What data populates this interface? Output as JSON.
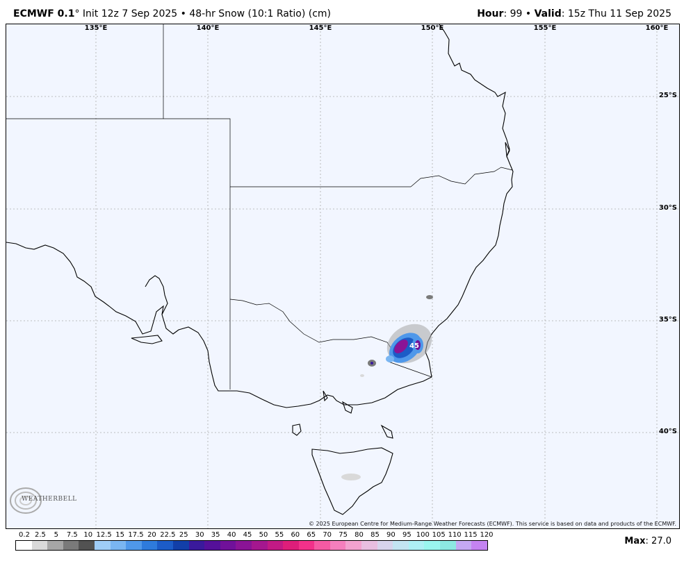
{
  "header": {
    "model": "ECMWF 0.1",
    "degree_mark": "°",
    "init": "Init 12z 7 Sep 2025",
    "bullet": "•",
    "product": "48-hr Snow (10:1 Ratio) (cm)",
    "hour_label": "Hour",
    "hour_value": ": 99",
    "valid_label": "Valid",
    "valid_value": ": 15z Thu 11 Sep 2025"
  },
  "map": {
    "longitude_labels": [
      "135°E",
      "140°E",
      "145°E",
      "150°E",
      "155°E",
      "160°E"
    ],
    "latitude_labels": [
      "25°S",
      "30°S",
      "35°S",
      "40°S"
    ],
    "contour_label": "45",
    "logo_text": "WEATHERBELL",
    "credit": "© 2025 European Centre for Medium-Range Weather Forecasts (ECMWF). This service is based on data and products of the ECMWF."
  },
  "legend": {
    "labels": [
      "0.2",
      "2.5",
      "5",
      "7.5",
      "10",
      "12.5",
      "15",
      "17.5",
      "20",
      "22.5",
      "25",
      "30",
      "35",
      "40",
      "45",
      "50",
      "55",
      "60",
      "65",
      "70",
      "75",
      "80",
      "85",
      "90",
      "95",
      "100",
      "105",
      "110",
      "115",
      "120"
    ],
    "colors": [
      "#ffffff",
      "#d9d9d9",
      "#a6a6a6",
      "#7a7a7a",
      "#525252",
      "#9fcdf7",
      "#7ab6f2",
      "#4f98ea",
      "#2e7bdc",
      "#1c5cc7",
      "#123fa8",
      "#3a1a9c",
      "#55109a",
      "#70119a",
      "#8a1496",
      "#a5178f",
      "#c21a85",
      "#de1e7a",
      "#f2318a",
      "#f55aa3",
      "#f57fbd",
      "#f2a2cf",
      "#e8bee0",
      "#d7d4ec",
      "#c3e4f2",
      "#aef0f5",
      "#9af6ef",
      "#8de8e2",
      "#c4a8f3",
      "#c483f2"
    ],
    "max_label": "Max",
    "max_value": ": 27.0"
  }
}
